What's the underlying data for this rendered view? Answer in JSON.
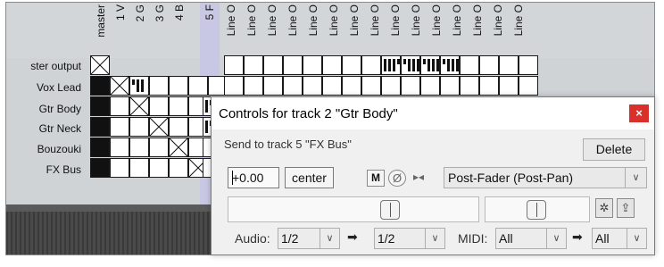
{
  "columns": [
    "master",
    "1 V",
    "2 G",
    "3 G",
    "4 B",
    "5 F",
    "Line O",
    "Line O",
    "Line O",
    "Line O",
    "Line O",
    "Line O",
    "Line O",
    "Line O",
    "Line O",
    "Line O",
    "Line O",
    "Line O",
    "Line O",
    "Line O",
    "Line O"
  ],
  "rows": {
    "master_output": "ster output",
    "vox_lead": "Vox Lead",
    "gtr_body": "Gtr Body",
    "gtr_neck": "Gtr Neck",
    "bouzouki": "Bouzouki",
    "fx_bus": "FX Bus"
  },
  "dialog": {
    "title": "Controls for track 2 \"Gtr Body\"",
    "close_label": "×",
    "send_label": "Send to track 5 \"FX Bus\"",
    "delete_label": "Delete",
    "volume_value": "+0.00",
    "pan_value": "center",
    "mute_label": "M",
    "phase_label": "Ø",
    "mono_label": "▸◂",
    "mode": "Post-Fader (Post-Pan)",
    "audio_label": "Audio:",
    "audio_src": "1/2",
    "audio_dst": "1/2",
    "midi_label": "MIDI:",
    "midi_src": "All",
    "midi_dst": "All",
    "arrow": "➡",
    "chevron": "∨",
    "env_icon": "✲",
    "auto_icon": "⇪"
  },
  "icons": {
    "phase": "phase-invert-icon",
    "mono": "mono-stereo-icon",
    "envelope": "envelope-icon",
    "automation": "automation-icon",
    "close": "close-icon"
  },
  "colors": {
    "close_bg": "#d9302c",
    "matrix_highlight": "#c8c8e4"
  }
}
